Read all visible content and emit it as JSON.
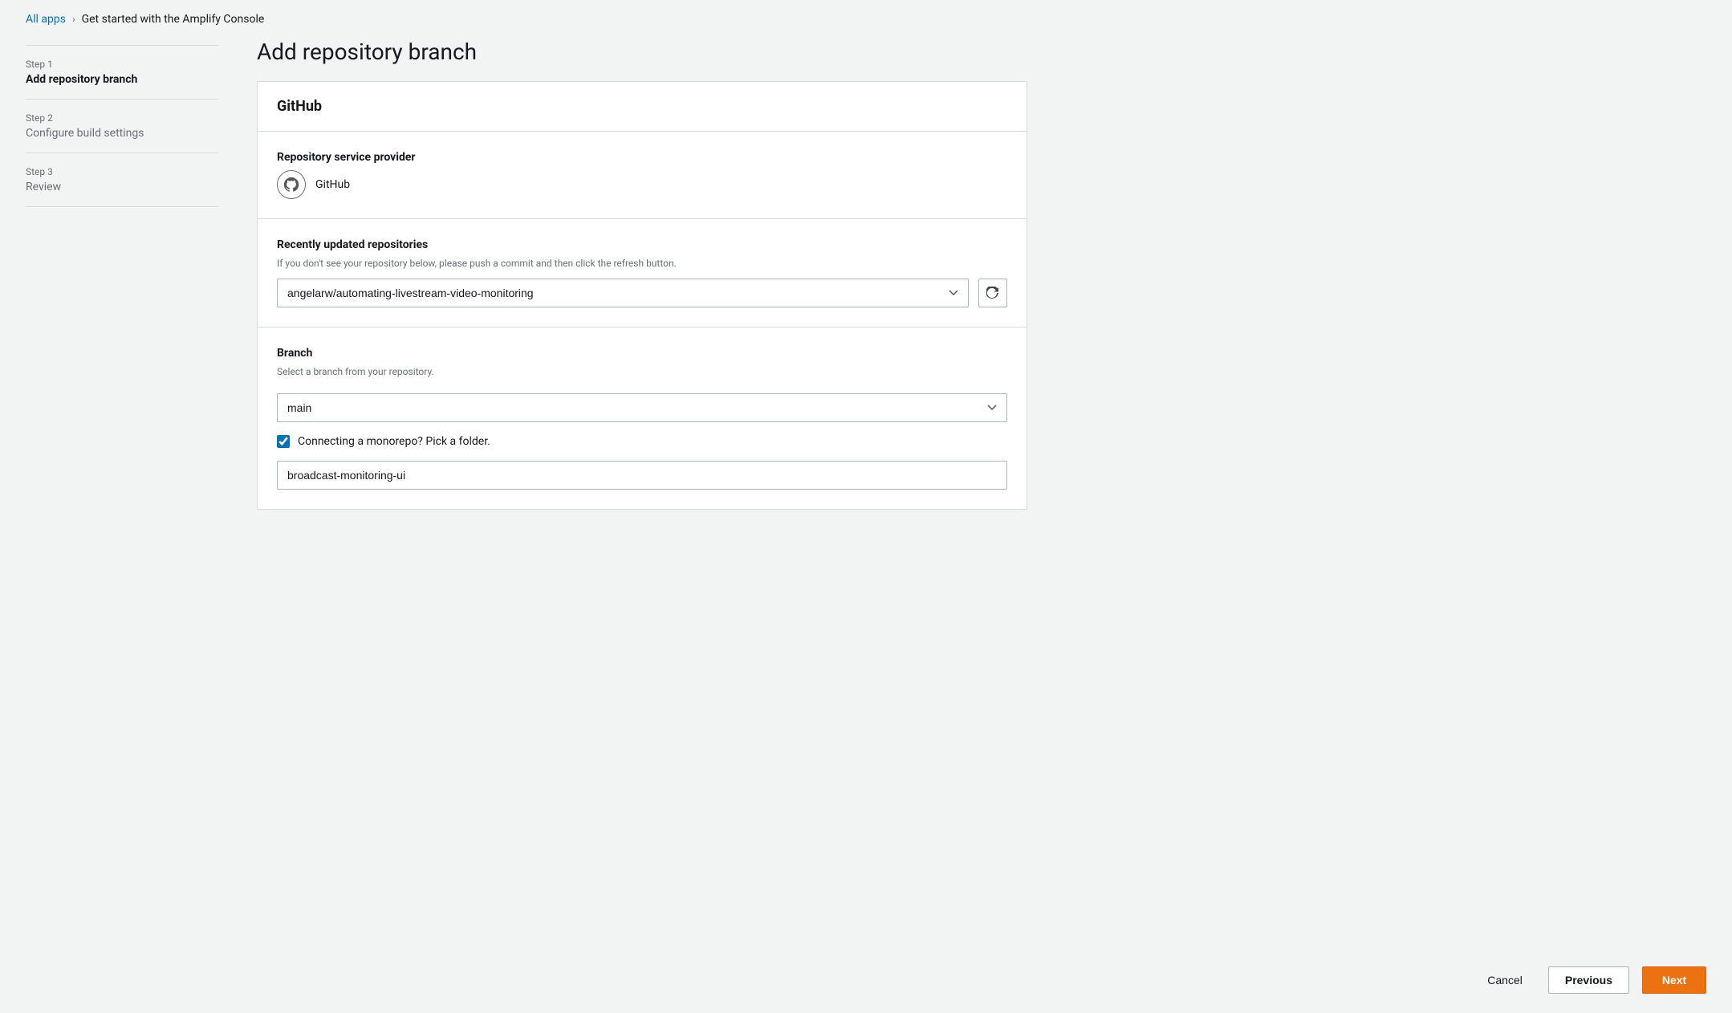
{
  "breadcrumb": {
    "link_label": "All apps",
    "separator": "›",
    "current": "Get started with the Amplify Console"
  },
  "steps": [
    {
      "number": "Step 1",
      "title": "Add repository branch",
      "active": true
    },
    {
      "number": "Step 2",
      "title": "Configure build settings",
      "active": false
    },
    {
      "number": "Step 3",
      "title": "Review",
      "active": false
    }
  ],
  "page_title": "Add repository branch",
  "card": {
    "header": "GitHub",
    "provider_section": {
      "label": "Repository service provider",
      "provider_name": "GitHub"
    },
    "repository_section": {
      "label": "Recently updated repositories",
      "hint": "If you don't see your repository below, please push a commit and then click the refresh button.",
      "selected_repo": "angelarw/automating-livestream-video-monitoring"
    },
    "branch_section": {
      "label": "Branch",
      "hint": "Select a branch from your repository.",
      "selected_branch": "main"
    },
    "monorepo_section": {
      "checkbox_label": "Connecting a monorepo? Pick a folder.",
      "folder_value": "broadcast-monitoring-ui"
    }
  },
  "footer": {
    "cancel_label": "Cancel",
    "previous_label": "Previous",
    "next_label": "Next"
  }
}
